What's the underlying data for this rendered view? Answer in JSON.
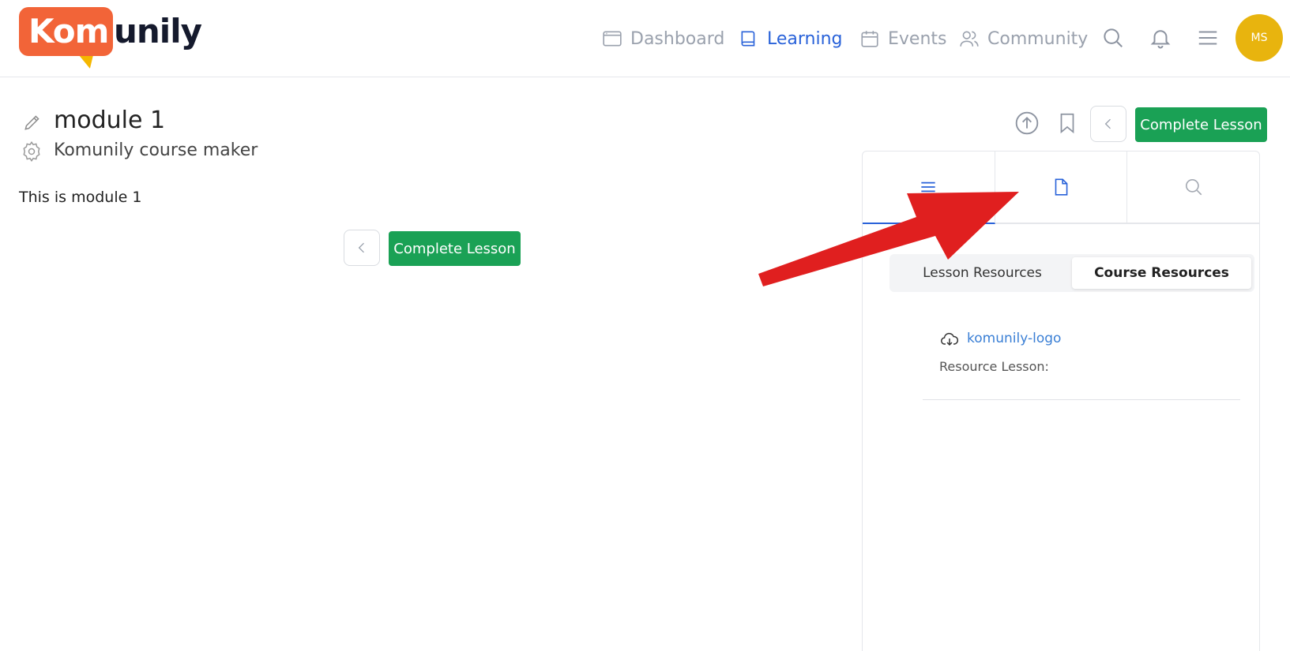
{
  "header": {
    "logo_part1": "Kom",
    "logo_part2": "unily",
    "nav": [
      {
        "label": "Dashboard",
        "icon": "dashboard-icon",
        "active": false
      },
      {
        "label": "Learning",
        "icon": "book-icon",
        "active": true
      },
      {
        "label": "Events",
        "icon": "calendar-icon",
        "active": false
      },
      {
        "label": "Community",
        "icon": "users-icon",
        "active": false
      }
    ],
    "avatar_initials": "MS"
  },
  "lesson": {
    "title": "module 1",
    "course": "Komunily course maker",
    "body": "This is module 1",
    "complete_label": "Complete Lesson"
  },
  "panel": {
    "tabs": [
      "list-icon",
      "document-icon",
      "search-icon"
    ],
    "segments": {
      "lesson": "Lesson Resources",
      "course": "Course Resources",
      "active": "course"
    },
    "resources": [
      {
        "name": "komunily-logo",
        "detail": "Resource Lesson:",
        "icon": "cloud-download-icon"
      }
    ]
  },
  "colors": {
    "brand_orange": "#f26438",
    "accent_blue": "#2962d9",
    "complete_green": "#1aa155",
    "avatar_yellow": "#e8b40e",
    "annotation_red": "#e01f1f"
  }
}
